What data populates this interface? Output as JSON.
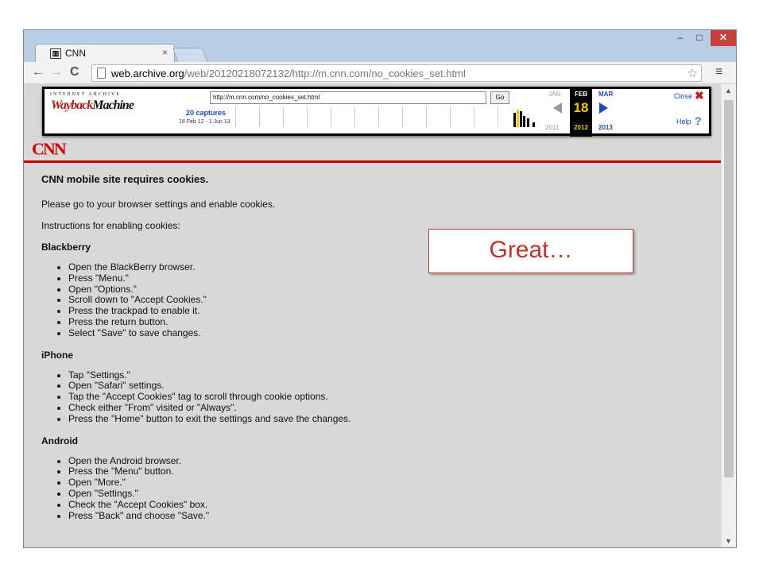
{
  "browser": {
    "tab_title": "CNN",
    "tab_close": "×",
    "url_host": "web.archive.org",
    "url_path": "/web/20120218072132/http://m.cnn.com/no_cookies_set.html",
    "win_min": "‒",
    "win_max": "□",
    "win_close": "✕"
  },
  "wayback": {
    "internet_archive": "INTERNET ARCHIVE",
    "logo_a": "Wayback",
    "logo_b": "Machine",
    "url_value": "http://m.cnn.com/no_cookies_set.html",
    "go_label": "Go",
    "captures": "20 captures",
    "range": "18 Feb 12 - 1 Jun 13",
    "month_prev": "JAN",
    "month_current": "FEB",
    "day_current": "18",
    "month_next": "MAR",
    "year_prev": "2011",
    "year_current": "2012",
    "year_next": "2013",
    "close_label": "Close",
    "close_icon": "✖",
    "help_label": "Help",
    "help_icon": "?"
  },
  "page": {
    "logo": "CNN",
    "title": "CNN mobile site requires cookies.",
    "intro": "Please go to your browser settings and enable cookies.",
    "instructions": "Instructions for enabling cookies:",
    "sections": [
      {
        "heading": "Blackberry",
        "items": [
          "Open the BlackBerry browser.",
          "Press \"Menu.\"",
          "Open \"Options.\"",
          "Scroll down to \"Accept Cookies.\"",
          "Press the trackpad to enable it.",
          "Press the return button.",
          "Select \"Save\" to save changes."
        ]
      },
      {
        "heading": "iPhone",
        "items": [
          "Tap \"Settings.\"",
          "Open \"Safari\" settings.",
          "Tap the \"Accept Cookies\" tag to scroll through cookie options.",
          "Check either \"From\" visited or \"Always\".",
          "Press the \"Home\" button to exit the settings and save the changes."
        ]
      },
      {
        "heading": "Android",
        "items": [
          "Open the Android browser.",
          "Press the \"Menu\" button.",
          "Open \"More.\"",
          "Open \"Settings.\"",
          "Check the \"Accept Cookies\" box.",
          "Press \"Back\" and choose \"Save.\""
        ]
      }
    ]
  },
  "callout": {
    "text": "Great…"
  },
  "colors": {
    "cnn_red": "#cc0000",
    "wayback_blue": "#1a4cb0",
    "wayback_gold": "#f4c800"
  }
}
